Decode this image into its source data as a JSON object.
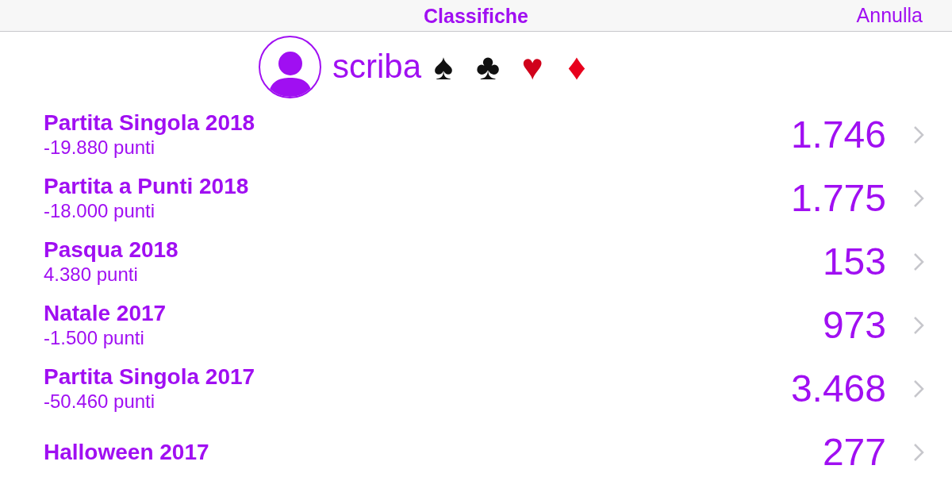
{
  "header": {
    "title": "Classifiche",
    "cancel": "Annulla"
  },
  "profile": {
    "name": "scriba",
    "suits": [
      {
        "symbol": "♠",
        "color": "#111111"
      },
      {
        "symbol": "♣",
        "color": "#111111"
      },
      {
        "symbol": "♥",
        "color": "#d0021b"
      },
      {
        "symbol": "♦",
        "color": "#e8001c"
      }
    ]
  },
  "rows": [
    {
      "title": "Partita Singola 2018",
      "points": "-19.880 punti",
      "rank": "1.746"
    },
    {
      "title": "Partita a Punti 2018",
      "points": "-18.000 punti",
      "rank": "1.775"
    },
    {
      "title": "Pasqua 2018",
      "points": "4.380 punti",
      "rank": "153"
    },
    {
      "title": "Natale 2017",
      "points": "-1.500 punti",
      "rank": "973"
    },
    {
      "title": "Partita Singola 2017",
      "points": "-50.460 punti",
      "rank": "3.468"
    },
    {
      "title": "Halloween 2017",
      "rank": "277"
    }
  ]
}
